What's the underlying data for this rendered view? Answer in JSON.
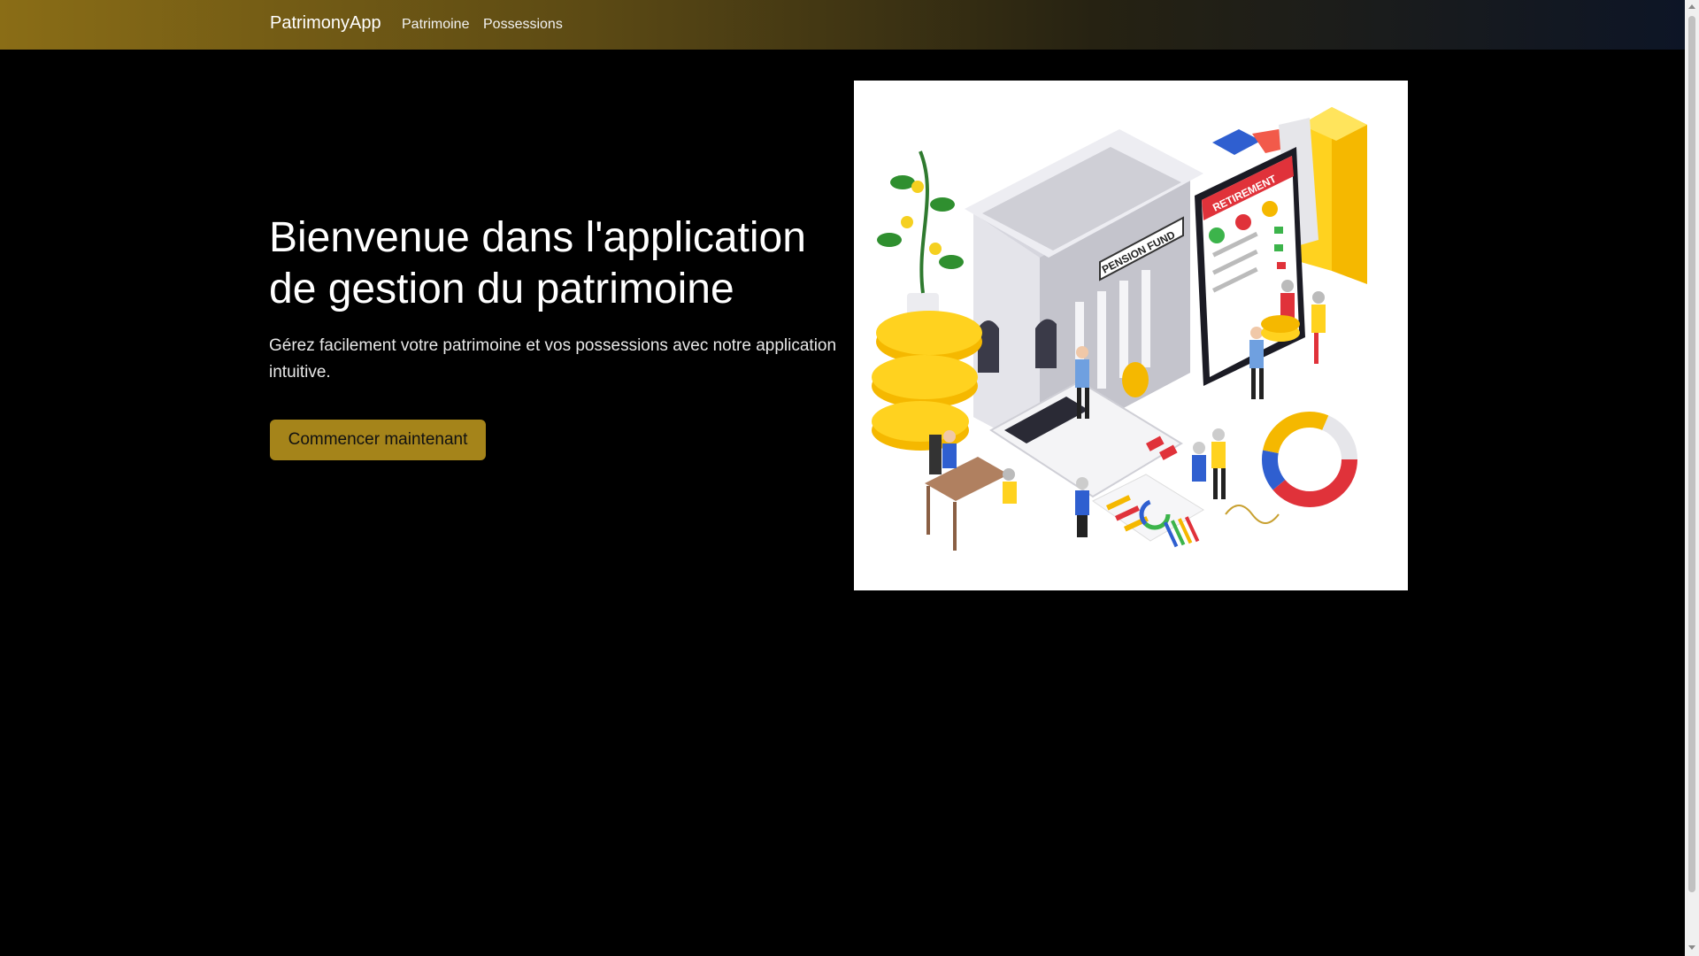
{
  "navbar": {
    "brand": "PatrimonyApp",
    "links": [
      "Patrimoine",
      "Possessions"
    ]
  },
  "hero": {
    "title": "Bienvenue dans l'application de gestion du patrimoine",
    "subtitle": "Gérez facilement votre patrimoine et vos possessions avec notre application intuitive.",
    "cta_label": "Commencer maintenant"
  },
  "illustration": {
    "sign_pension": "PENSION FUND",
    "sign_retirement": "RETIREMENT"
  },
  "colors": {
    "accent": "#a5841a",
    "navbar_start": "#8a6d16",
    "navbar_end": "#0d1526",
    "background": "#000000"
  }
}
